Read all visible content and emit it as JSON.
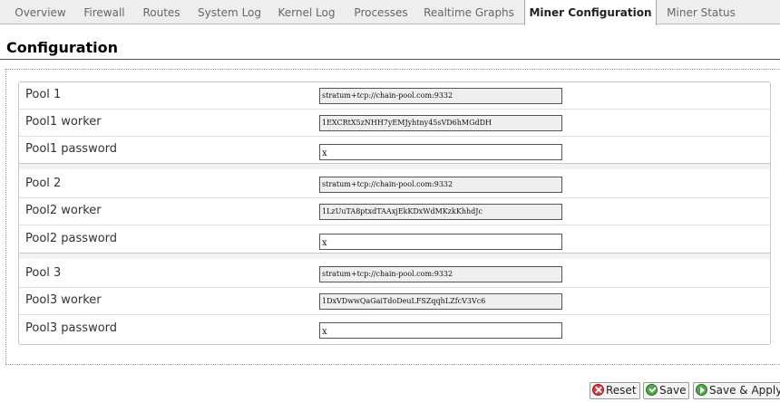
{
  "tabs": [
    {
      "label": "Overview"
    },
    {
      "label": "Firewall"
    },
    {
      "label": "Routes"
    },
    {
      "label": "System Log"
    },
    {
      "label": "Kernel Log"
    },
    {
      "label": "Processes"
    },
    {
      "label": "Realtime Graphs"
    },
    {
      "label": "Miner Configuration",
      "active": true
    },
    {
      "label": "Miner Status"
    }
  ],
  "page": {
    "title": "Configuration"
  },
  "pools": [
    {
      "url_label": "Pool 1",
      "url": "stratum+tcp://chain-pool.com:9332",
      "worker_label": "Pool1 worker",
      "worker": "1EXCRtX5zNHH7yEMJyhtny45sVD6hMGdDH",
      "password_label": "Pool1 password",
      "password": "x"
    },
    {
      "url_label": "Pool 2",
      "url": "stratum+tcp://chain-pool.com:9332",
      "worker_label": "Pool2 worker",
      "worker": "1LzUuTA8ptxdTAAxjEkKDxWdMKzkKhhdJc",
      "password_label": "Pool2 password",
      "password": "x"
    },
    {
      "url_label": "Pool 3",
      "url": "stratum+tcp://chain-pool.com:9332",
      "worker_label": "Pool3 worker",
      "worker": "1DxVDwwQaGaiTdoDeuLFSZqqhLZfcV3Vc6",
      "password_label": "Pool3 password",
      "password": "x"
    }
  ],
  "buttons": {
    "reset": "Reset",
    "save": "Save",
    "save_apply": "Save & Apply"
  },
  "colors": {
    "active_tab_bg": "#ffffff",
    "tab_bar_bg": "#eeeeee",
    "save_icon": "#4fa84a",
    "reset_icon": "#d63b3b"
  }
}
